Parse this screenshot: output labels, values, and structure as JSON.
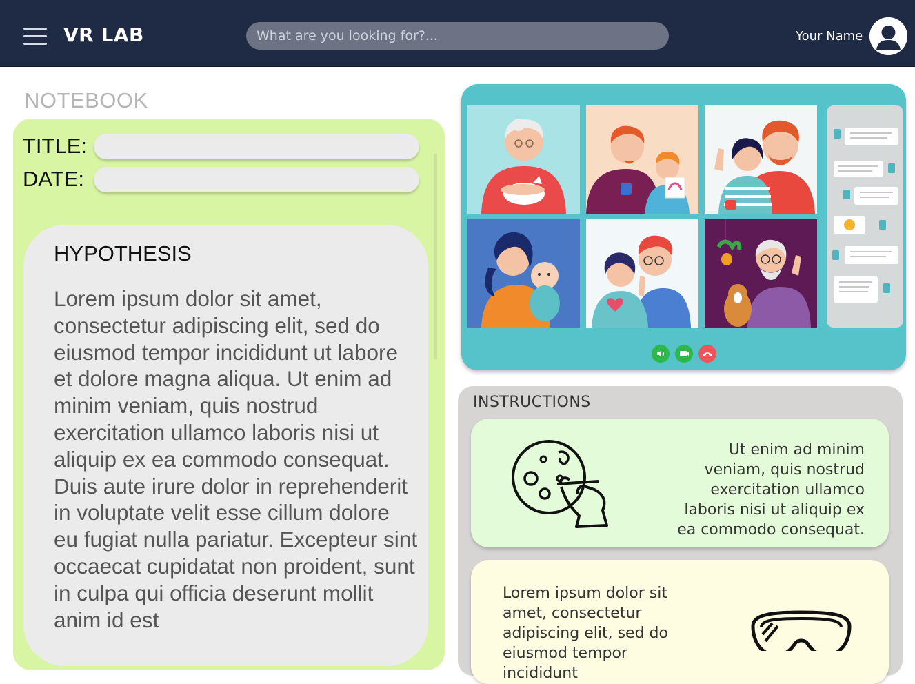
{
  "header": {
    "app_title": "VR LAB",
    "search_placeholder": "What are you looking for?...",
    "user_name": "Your Name",
    "icons": {
      "menu": "hamburger-menu-icon",
      "avatar": "user-avatar-icon"
    }
  },
  "notebook": {
    "label": "NOTEBOOK",
    "title_label": "TITLE:",
    "date_label": "DATE:",
    "title_value": "",
    "date_value": "",
    "hypothesis": {
      "heading": "HYPOTHESIS",
      "body": "Lorem ipsum dolor sit amet, consectetur adipiscing elit, sed do eiusmod tempor incididunt ut labore et dolore magna aliqua. Ut enim ad minim veniam, quis nostrud exercitation ullamco laboris nisi ut aliquip ex ea commodo consequat. Duis aute irure dolor in reprehenderit in voluptate velit esse cillum dolore eu fugiat nulla pariatur. Excepteur sint occaecat cupidatat non proident, sunt in culpa qui officia deserunt mollit anim id est"
    }
  },
  "video_call": {
    "participants": [
      "grandmother-with-cat",
      "father-with-daughter",
      "waving-couple",
      "mother-with-baby",
      "girl-and-man",
      "grandfather-with-dog"
    ],
    "controls": [
      "audio-button",
      "camera-button",
      "hang-up-button"
    ],
    "colors": {
      "panel": "#55c3c9",
      "audio": "#2db84b",
      "camera": "#2db84b",
      "hangup": "#f0545a"
    }
  },
  "instructions": {
    "label": "INSTRUCTIONS",
    "cards": [
      {
        "icon": "petri-dish-icon",
        "text": "Ut enim ad minim veniam, quis nostrud exercitation ullamco laboris nisi ut aliquip ex ea commodo consequat."
      },
      {
        "icon": "safety-goggles-icon",
        "text": "Lorem ipsum dolor sit amet, consectetur adipiscing elit, sed do eiusmod tempor incididunt"
      }
    ]
  },
  "colors": {
    "topbar": "#1f2a44",
    "notebook_panel": "#d8f5a4",
    "hypothesis_card": "#ecebeb",
    "instructions_panel": "#d7d4d4",
    "card_green": "#e4fbd9",
    "card_yellow": "#fefde2"
  }
}
